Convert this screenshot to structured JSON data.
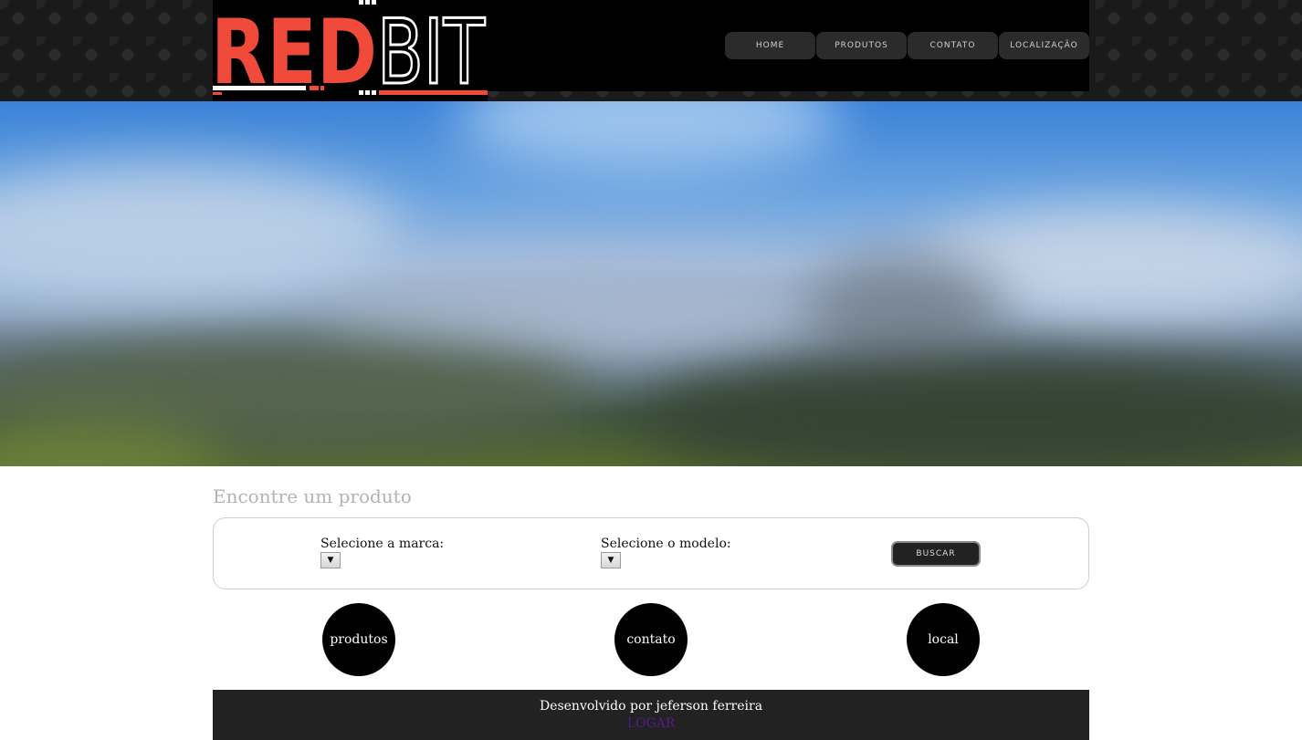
{
  "brand": {
    "logo_left": "RED",
    "logo_right": "BIT",
    "colors": {
      "red": "#f04a3a",
      "white": "#ffffff",
      "black": "#000000"
    }
  },
  "nav": {
    "items": [
      {
        "label": "HOME"
      },
      {
        "label": "PRODUTOS"
      },
      {
        "label": "CONTATO"
      },
      {
        "label": "LOCALIZAÇÃO"
      }
    ]
  },
  "search": {
    "title": "Encontre um produto",
    "brand_label": "Selecione a marca:",
    "model_label": "Selecione o modelo:",
    "dropdown_arrow": "▼",
    "button_label": "BUSCAR"
  },
  "circles": [
    {
      "label": "produtos"
    },
    {
      "label": "contato"
    },
    {
      "label": "local"
    }
  ],
  "footer": {
    "credit": "Desenvolvido por jeferson ferreira",
    "login": "LOGAR"
  }
}
